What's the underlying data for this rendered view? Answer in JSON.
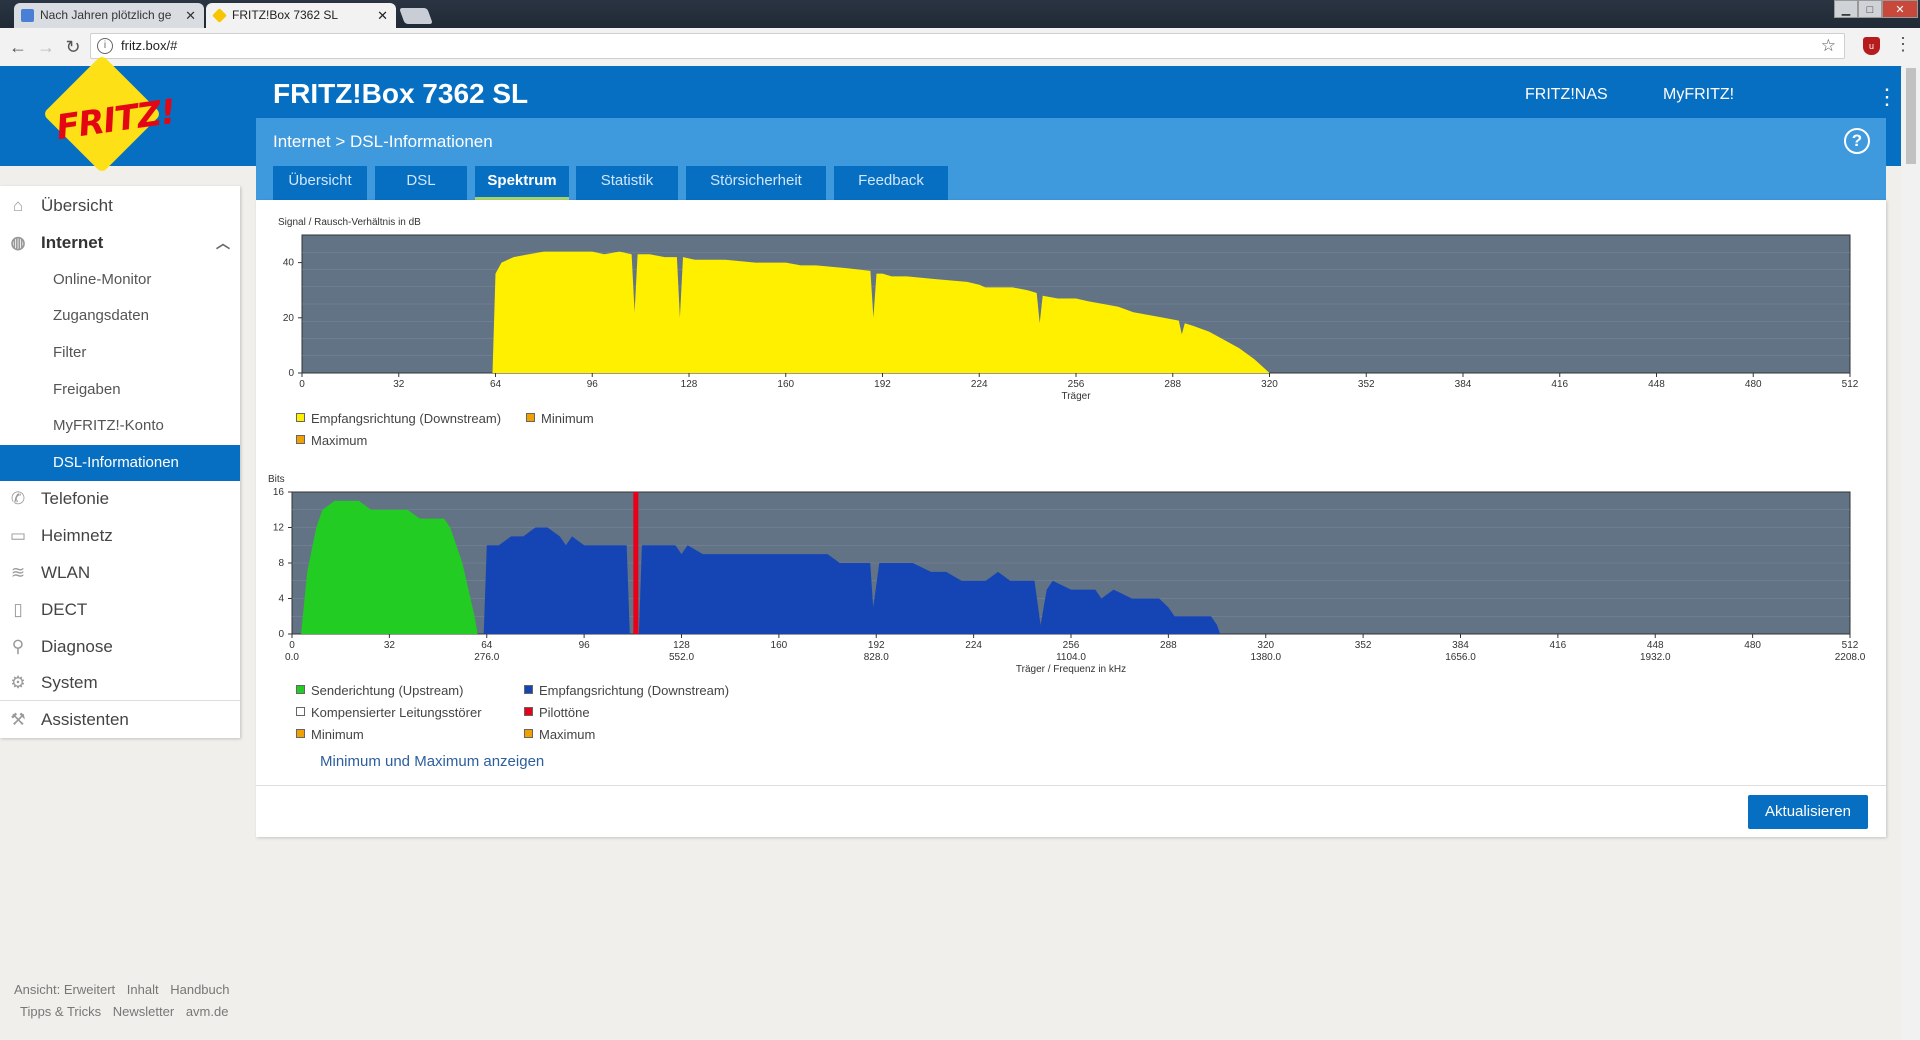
{
  "browser": {
    "tabs": [
      {
        "title": "Nach Jahren plötzlich ge",
        "close": "✕"
      },
      {
        "title": "FRITZ!Box 7362 SL",
        "close": "✕"
      }
    ],
    "url": "fritz.box/#",
    "window_buttons": [
      "▁",
      "□",
      "✕"
    ]
  },
  "header": {
    "logo_text": "FRITZ!",
    "title": "FRITZ!Box 7362 SL",
    "links": [
      "FRITZ!NAS",
      "MyFRITZ!"
    ]
  },
  "breadcrumb": "Internet > DSL-Informationen",
  "tabs": [
    {
      "label": "Übersicht",
      "active": false
    },
    {
      "label": "DSL",
      "active": false
    },
    {
      "label": "Spektrum",
      "active": true
    },
    {
      "label": "Statistik",
      "active": false
    },
    {
      "label": "Störsicherheit",
      "active": false
    },
    {
      "label": "Feedback",
      "active": false
    }
  ],
  "sidebar": {
    "items": [
      {
        "label": "Übersicht",
        "icon": "home-icon"
      },
      {
        "label": "Internet",
        "icon": "globe-icon"
      },
      {
        "label": "Telefonie",
        "icon": "phone-icon"
      },
      {
        "label": "Heimnetz",
        "icon": "network-icon"
      },
      {
        "label": "WLAN",
        "icon": "wifi-icon"
      },
      {
        "label": "DECT",
        "icon": "dect-icon"
      },
      {
        "label": "Diagnose",
        "icon": "diagnose-icon"
      },
      {
        "label": "System",
        "icon": "system-icon"
      },
      {
        "label": "Assistenten",
        "icon": "wizard-icon"
      }
    ],
    "internet_sub": [
      "Online-Monitor",
      "Zugangsdaten",
      "Filter",
      "Freigaben",
      "MyFRITZ!-Konto",
      "DSL-Informationen"
    ],
    "active_sub": "DSL-Informationen"
  },
  "colors": {
    "brand_blue": "#076fc2",
    "chart_bg": "#627385",
    "downstream_snr": "#fff000",
    "upstream": "#22cc22",
    "downstream_bits": "#1545b5",
    "pilot": "#e8001a",
    "minmax": "#f0a000"
  },
  "chart_data": [
    {
      "type": "area",
      "title": "Signal / Rausch-Verhältnis in dB",
      "xlabel": "Träger",
      "ylabel": "Signal / Rausch-Verhältnis in dB",
      "xlim": [
        0,
        512
      ],
      "ylim": [
        0,
        50
      ],
      "xticks": [
        0,
        32,
        64,
        96,
        128,
        160,
        192,
        224,
        256,
        288,
        320,
        352,
        384,
        416,
        448,
        480,
        512
      ],
      "yticks": [
        0,
        20,
        40
      ],
      "series": [
        {
          "name": "Empfangsrichtung (Downstream)",
          "x": [
            63,
            64,
            66,
            70,
            75,
            80,
            85,
            90,
            96,
            100,
            105,
            109,
            110,
            111,
            115,
            120,
            124,
            125,
            126,
            130,
            140,
            150,
            160,
            165,
            170,
            180,
            188,
            189,
            190,
            192,
            195,
            200,
            210,
            220,
            224,
            226,
            228,
            235,
            240,
            243,
            244,
            245,
            250,
            256,
            260,
            265,
            270,
            275,
            280,
            285,
            290,
            291,
            292,
            295,
            300,
            305,
            310,
            315,
            318,
            320
          ],
          "values": [
            0,
            36,
            40,
            42,
            43,
            44,
            44,
            44,
            44,
            43,
            44,
            43,
            22,
            43,
            43,
            42,
            42,
            20,
            42,
            41,
            41,
            40,
            40,
            39,
            39,
            38,
            37,
            20,
            36,
            36,
            35,
            35,
            34,
            33,
            32,
            31,
            31,
            31,
            30,
            29,
            18,
            28,
            27,
            27,
            26,
            25,
            24,
            22,
            21,
            20,
            19,
            14,
            18,
            17,
            15,
            12,
            9,
            5,
            2,
            0
          ]
        }
      ],
      "legend": [
        "Empfangsrichtung (Downstream)",
        "Minimum",
        "Maximum"
      ]
    },
    {
      "type": "area",
      "title": "Bits",
      "xlabel": "Träger / Frequenz in kHz",
      "ylabel": "Bits",
      "xlim": [
        0,
        512
      ],
      "ylim": [
        0,
        16
      ],
      "xticks": [
        0,
        32,
        64,
        96,
        128,
        160,
        192,
        224,
        256,
        288,
        320,
        352,
        384,
        416,
        448,
        480,
        512
      ],
      "yticks": [
        0,
        4,
        8,
        12,
        16
      ],
      "freq_ticks": [
        {
          "x": 0,
          "label": "0.0"
        },
        {
          "x": 64,
          "label": "276.0"
        },
        {
          "x": 128,
          "label": "552.0"
        },
        {
          "x": 192,
          "label": "828.0"
        },
        {
          "x": 256,
          "label": "1104.0"
        },
        {
          "x": 320,
          "label": "1380.0"
        },
        {
          "x": 384,
          "label": "1656.0"
        },
        {
          "x": 448,
          "label": "1932.0"
        },
        {
          "x": 512,
          "label": "2208.0"
        }
      ],
      "series": [
        {
          "name": "Senderichtung (Upstream)",
          "x": [
            3,
            5,
            8,
            10,
            14,
            18,
            22,
            26,
            30,
            34,
            38,
            42,
            46,
            50,
            52,
            54,
            56,
            58,
            60,
            61
          ],
          "values": [
            0,
            7,
            12,
            14,
            15,
            15,
            15,
            14,
            14,
            14,
            14,
            13,
            13,
            13,
            12,
            10,
            8,
            5,
            2,
            0
          ]
        },
        {
          "name": "Empfangsrichtung (Downstream)",
          "x": [
            63,
            64,
            68,
            72,
            76,
            80,
            84,
            88,
            90,
            92,
            96,
            100,
            104,
            110,
            111,
            114,
            115,
            116,
            120,
            126,
            128,
            130,
            135,
            140,
            150,
            160,
            170,
            176,
            180,
            190,
            191,
            193,
            200,
            204,
            210,
            215,
            220,
            224,
            228,
            232,
            236,
            240,
            244,
            246,
            248,
            250,
            256,
            260,
            264,
            266,
            270,
            276,
            280,
            285,
            288,
            290,
            292,
            293,
            295,
            300,
            302,
            304,
            305
          ],
          "values": [
            0,
            10,
            10,
            11,
            11,
            12,
            12,
            11,
            10,
            11,
            10,
            10,
            10,
            10,
            0,
            0,
            10,
            10,
            10,
            10,
            9,
            10,
            9,
            9,
            9,
            9,
            9,
            9,
            8,
            8,
            3,
            8,
            8,
            8,
            7,
            7,
            6,
            6,
            6,
            7,
            6,
            6,
            6,
            1,
            5,
            6,
            5,
            5,
            5,
            4,
            5,
            4,
            4,
            4,
            3,
            2,
            2,
            2,
            2,
            2,
            2,
            1,
            0
          ]
        },
        {
          "name": "Pilottöne",
          "x": [
            113
          ],
          "values": [
            16
          ]
        }
      ],
      "legend": [
        "Senderichtung (Upstream)",
        "Empfangsrichtung (Downstream)",
        "Kompensierter Leitungsstörer",
        "Pilottöne",
        "Minimum",
        "Maximum"
      ]
    }
  ],
  "show_minmax_link": "Minimum und Maximum anzeigen",
  "refresh_button": "Aktualisieren",
  "footer": {
    "row1": [
      "Ansicht: Erweitert",
      "Inhalt",
      "Handbuch"
    ],
    "row2": [
      "Tipps & Tricks",
      "Newsletter",
      "avm.de"
    ]
  }
}
